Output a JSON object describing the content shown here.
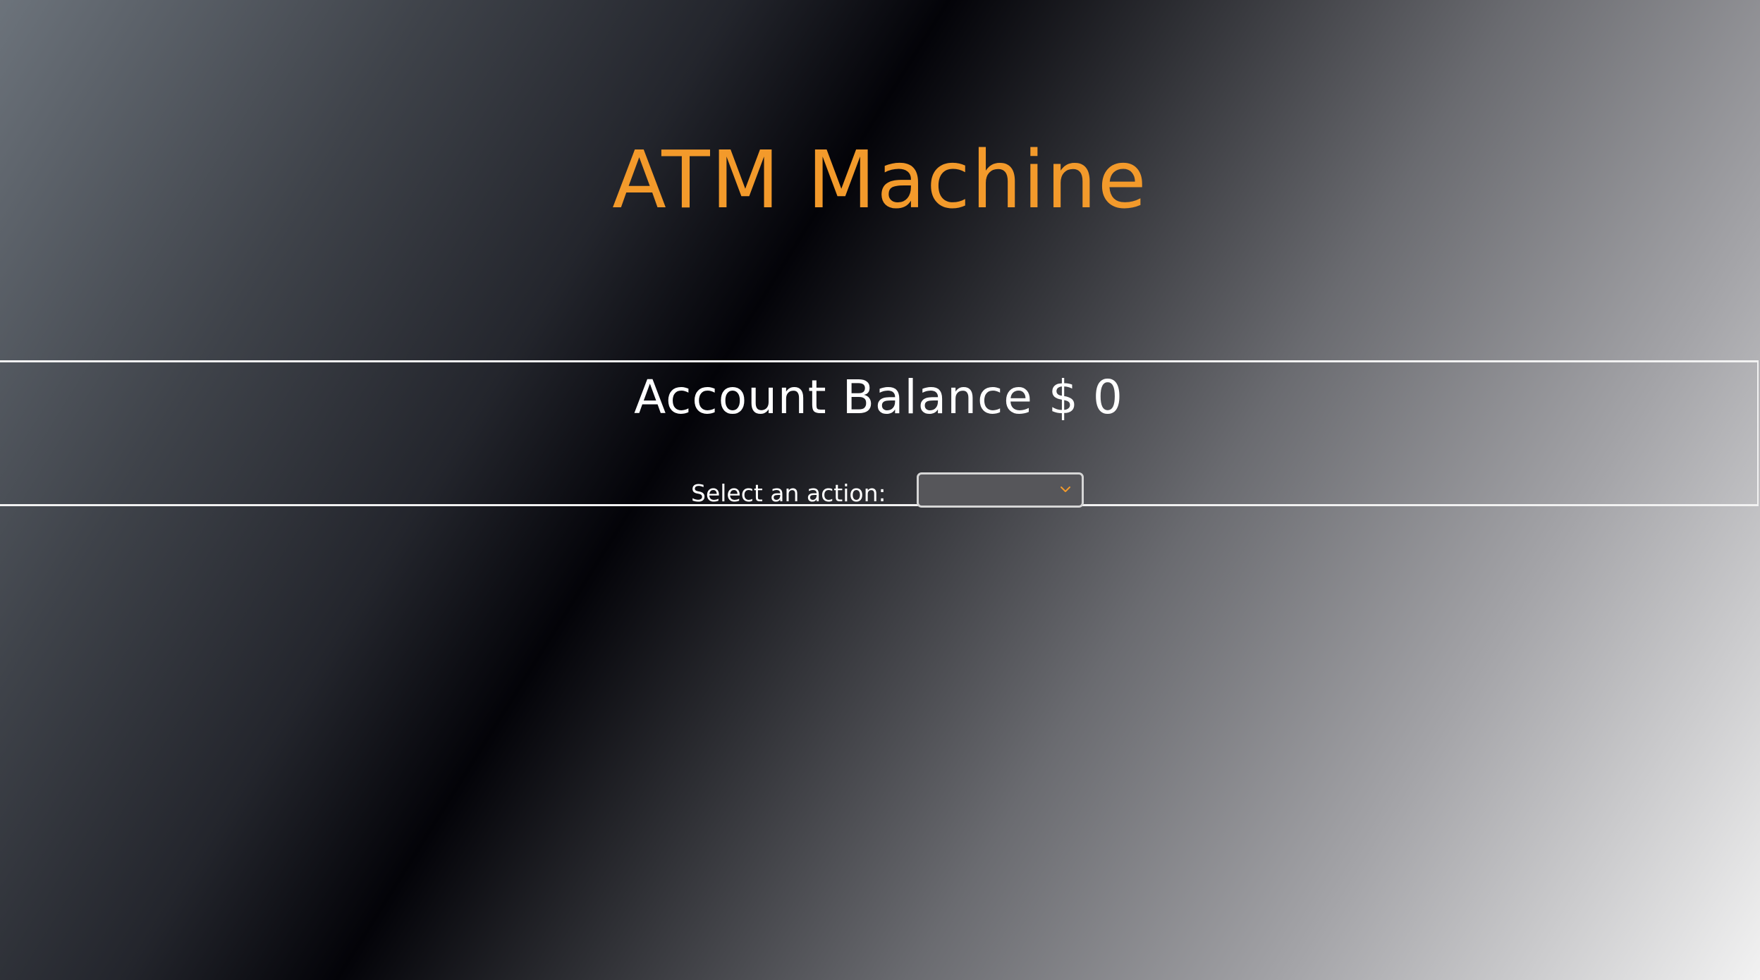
{
  "header": {
    "title": "ATM Machine"
  },
  "balance": {
    "label": "Account Balance $",
    "amount": "0"
  },
  "action": {
    "label": "Select an action:",
    "selected_value": ""
  },
  "colors": {
    "accent": "#f39a2b",
    "text": "#ffffff",
    "select_bg": "#56565a",
    "border": "#f2f2f2"
  },
  "icons": {
    "dropdown": "chevron-down-icon"
  }
}
